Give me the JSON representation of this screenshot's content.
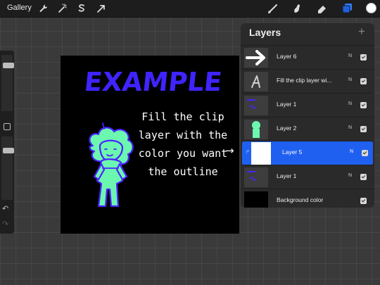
{
  "toolbar": {
    "gallery_label": "Gallery",
    "left_tools": [
      "wrench-icon",
      "magic-wand-icon",
      "selection-s-icon",
      "transform-arrow-icon"
    ],
    "right_tools": [
      "brush-icon",
      "smudge-icon",
      "eraser-icon",
      "layers-icon"
    ],
    "active_color": "#ffffff"
  },
  "sidebar": {
    "brush_size_level": 0.15,
    "opacity_level": 0.8
  },
  "canvas": {
    "background": "#000000",
    "title_text": "EXAMPLE",
    "title_color": "#3f24ff",
    "caption_lines": [
      "Fill the clip",
      "layer with the",
      "color you want",
      "the outline"
    ],
    "figure_fill": "#6cf7b0",
    "figure_outline": "#4b22ff"
  },
  "annotation_arrow": "→",
  "layers": {
    "title": "Layers",
    "add_label": "+",
    "items": [
      {
        "name": "Layer 6",
        "blend": "N",
        "thumb": "arrow"
      },
      {
        "name": "Fill the clip layer wi...",
        "blend": "N",
        "thumb": "text"
      },
      {
        "name": "Layer 1",
        "blend": "N",
        "thumb": "purple-scribble"
      },
      {
        "name": "Layer 2",
        "blend": "N",
        "thumb": "green-figure"
      },
      {
        "name": "Layer 5",
        "blend": "N",
        "thumb": "white",
        "selected": true,
        "clipped": true
      },
      {
        "name": "Layer 1",
        "blend": "N",
        "thumb": "purple-scribble"
      },
      {
        "name": "Background color",
        "blend": "",
        "thumb": "black"
      }
    ]
  }
}
